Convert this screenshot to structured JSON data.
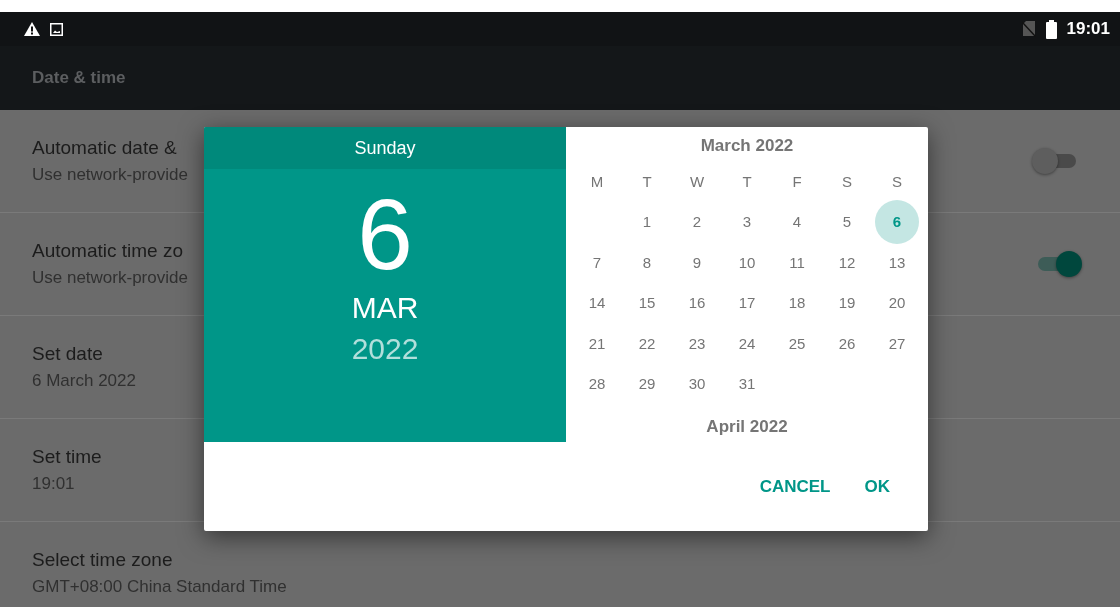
{
  "status_bar": {
    "time": "19:01"
  },
  "toolbar": {
    "title": "Date & time"
  },
  "settings": [
    {
      "kind": "toggle",
      "title": "Automatic date &",
      "subtitle": "Use network-provide",
      "on": false
    },
    {
      "kind": "toggle",
      "title": "Automatic time zo",
      "subtitle": "Use network-provide",
      "on": true
    },
    {
      "kind": "text",
      "title": "Set date",
      "subtitle": "6 March 2022"
    },
    {
      "kind": "text",
      "title": "Set time",
      "subtitle": "19:01"
    },
    {
      "kind": "text",
      "title": "Select time zone",
      "subtitle": "GMT+08:00 China Standard Time"
    }
  ],
  "dialog": {
    "weekday": "Sunday",
    "day": "6",
    "month": "MAR",
    "year": "2022",
    "month_title": "March 2022",
    "next_month_title": "April 2022",
    "weekday_headers": [
      "M",
      "T",
      "W",
      "T",
      "F",
      "S",
      "S"
    ],
    "weeks": [
      {
        "kind": "first",
        "days": [
          {
            "label": "1",
            "selected": false
          },
          {
            "label": "2",
            "selected": false
          },
          {
            "label": "3",
            "selected": false
          },
          {
            "label": "4",
            "selected": false
          },
          {
            "label": "5",
            "selected": false
          },
          {
            "label": "6",
            "selected": true
          }
        ]
      },
      {
        "kind": "full",
        "days": [
          {
            "label": "7",
            "selected": false
          },
          {
            "label": "8",
            "selected": false
          },
          {
            "label": "9",
            "selected": false
          },
          {
            "label": "10",
            "selected": false
          },
          {
            "label": "11",
            "selected": false
          },
          {
            "label": "12",
            "selected": false
          },
          {
            "label": "13",
            "selected": false
          }
        ]
      },
      {
        "kind": "full",
        "days": [
          {
            "label": "14",
            "selected": false
          },
          {
            "label": "15",
            "selected": false
          },
          {
            "label": "16",
            "selected": false
          },
          {
            "label": "17",
            "selected": false
          },
          {
            "label": "18",
            "selected": false
          },
          {
            "label": "19",
            "selected": false
          },
          {
            "label": "20",
            "selected": false
          }
        ]
      },
      {
        "kind": "full",
        "days": [
          {
            "label": "21",
            "selected": false
          },
          {
            "label": "22",
            "selected": false
          },
          {
            "label": "23",
            "selected": false
          },
          {
            "label": "24",
            "selected": false
          },
          {
            "label": "25",
            "selected": false
          },
          {
            "label": "26",
            "selected": false
          },
          {
            "label": "27",
            "selected": false
          }
        ]
      },
      {
        "kind": "last",
        "days": [
          {
            "label": "28",
            "selected": false
          },
          {
            "label": "29",
            "selected": false
          },
          {
            "label": "30",
            "selected": false
          },
          {
            "label": "31",
            "selected": false
          }
        ]
      }
    ],
    "buttons": [
      "CANCEL",
      "OK"
    ]
  }
}
